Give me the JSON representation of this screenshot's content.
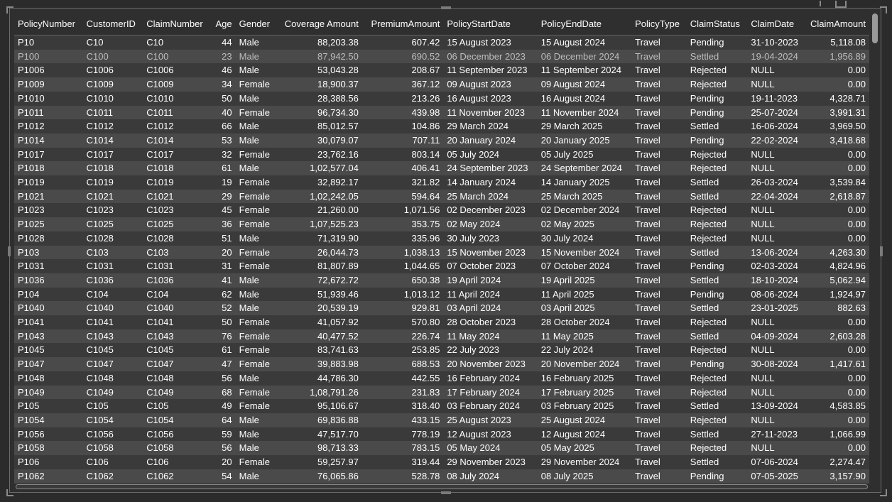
{
  "columns": [
    {
      "key": "PolicyNumber",
      "label": "PolicyNumber",
      "align": "left",
      "width": 97
    },
    {
      "key": "CustomerID",
      "label": "CustomerID",
      "align": "left",
      "width": 85
    },
    {
      "key": "ClaimNumber",
      "label": "ClaimNumber",
      "align": "left",
      "width": 95
    },
    {
      "key": "Age",
      "label": "Age",
      "align": "right",
      "width": 36
    },
    {
      "key": "Gender",
      "label": "Gender",
      "align": "left",
      "width": 57
    },
    {
      "key": "CoverageAmount",
      "label": "Coverage Amount",
      "align": "right",
      "width": 122
    },
    {
      "key": "PremiumAmount",
      "label": "PremiumAmount",
      "align": "right",
      "width": 115
    },
    {
      "key": "PolicyStartDate",
      "label": "PolicyStartDate",
      "align": "left",
      "width": 133
    },
    {
      "key": "PolicyEndDate",
      "label": "PolicyEndDate",
      "align": "left",
      "width": 133
    },
    {
      "key": "PolicyType",
      "label": "PolicyType",
      "align": "left",
      "width": 78
    },
    {
      "key": "ClaimStatus",
      "label": "ClaimStatus",
      "align": "left",
      "width": 86
    },
    {
      "key": "ClaimDate",
      "label": "ClaimDate",
      "align": "left",
      "width": 83
    },
    {
      "key": "ClaimAmount",
      "label": "ClaimAmount",
      "align": "right",
      "width": 89
    }
  ],
  "rows": [
    [
      "P10",
      "C10",
      "C10",
      "44",
      "Male",
      "88,203.38",
      "607.42",
      "15 August 2023",
      "15 August 2024",
      "Travel",
      "Pending",
      "31-10-2023",
      "5,118.08"
    ],
    [
      "P100",
      "C100",
      "C100",
      "23",
      "Male",
      "87,942.50",
      "690.52",
      "06 December 2023",
      "06 December 2024",
      "Travel",
      "Settled",
      "19-04-2024",
      "1,956.89"
    ],
    [
      "P1006",
      "C1006",
      "C1006",
      "46",
      "Male",
      "53,043.28",
      "208.67",
      "11 September 2023",
      "11 September 2024",
      "Travel",
      "Rejected",
      "NULL",
      "0.00"
    ],
    [
      "P1009",
      "C1009",
      "C1009",
      "34",
      "Female",
      "18,900.37",
      "367.12",
      "09 August 2023",
      "09 August 2024",
      "Travel",
      "Rejected",
      "NULL",
      "0.00"
    ],
    [
      "P1010",
      "C1010",
      "C1010",
      "50",
      "Male",
      "28,388.56",
      "213.26",
      "16 August 2023",
      "16 August 2024",
      "Travel",
      "Pending",
      "19-11-2023",
      "4,328.71"
    ],
    [
      "P1011",
      "C1011",
      "C1011",
      "40",
      "Female",
      "96,734.30",
      "439.98",
      "11 November 2023",
      "11 November 2024",
      "Travel",
      "Pending",
      "25-07-2024",
      "3,991.31"
    ],
    [
      "P1012",
      "C1012",
      "C1012",
      "66",
      "Male",
      "85,012.57",
      "104.86",
      "29 March 2024",
      "29 March 2025",
      "Travel",
      "Settled",
      "16-06-2024",
      "3,969.50"
    ],
    [
      "P1014",
      "C1014",
      "C1014",
      "53",
      "Male",
      "30,079.07",
      "707.11",
      "20 January 2024",
      "20 January 2025",
      "Travel",
      "Pending",
      "22-02-2024",
      "3,418.68"
    ],
    [
      "P1017",
      "C1017",
      "C1017",
      "32",
      "Female",
      "23,762.16",
      "803.14",
      "05 July 2024",
      "05 July 2025",
      "Travel",
      "Rejected",
      "NULL",
      "0.00"
    ],
    [
      "P1018",
      "C1018",
      "C1018",
      "61",
      "Male",
      "1,02,577.04",
      "406.41",
      "24 September 2023",
      "24 September 2024",
      "Travel",
      "Rejected",
      "NULL",
      "0.00"
    ],
    [
      "P1019",
      "C1019",
      "C1019",
      "19",
      "Female",
      "32,892.17",
      "321.82",
      "14 January 2024",
      "14 January 2025",
      "Travel",
      "Settled",
      "26-03-2024",
      "3,539.84"
    ],
    [
      "P1021",
      "C1021",
      "C1021",
      "29",
      "Female",
      "1,02,242.05",
      "594.64",
      "25 March 2024",
      "25 March 2025",
      "Travel",
      "Settled",
      "22-04-2024",
      "2,618.87"
    ],
    [
      "P1023",
      "C1023",
      "C1023",
      "45",
      "Female",
      "21,260.00",
      "1,071.56",
      "02 December 2023",
      "02 December 2024",
      "Travel",
      "Rejected",
      "NULL",
      "0.00"
    ],
    [
      "P1025",
      "C1025",
      "C1025",
      "36",
      "Female",
      "1,07,525.23",
      "353.75",
      "02 May 2024",
      "02 May 2025",
      "Travel",
      "Rejected",
      "NULL",
      "0.00"
    ],
    [
      "P1028",
      "C1028",
      "C1028",
      "51",
      "Male",
      "71,319.90",
      "335.96",
      "30 July 2023",
      "30 July 2024",
      "Travel",
      "Rejected",
      "NULL",
      "0.00"
    ],
    [
      "P103",
      "C103",
      "C103",
      "20",
      "Female",
      "26,044.73",
      "1,038.13",
      "15 November 2023",
      "15 November 2024",
      "Travel",
      "Settled",
      "13-06-2024",
      "4,263.30"
    ],
    [
      "P1031",
      "C1031",
      "C1031",
      "31",
      "Female",
      "81,807.89",
      "1,044.65",
      "07 October 2023",
      "07 October 2024",
      "Travel",
      "Pending",
      "02-03-2024",
      "4,824.96"
    ],
    [
      "P1036",
      "C1036",
      "C1036",
      "41",
      "Male",
      "72,672.72",
      "650.38",
      "19 April 2024",
      "19 April 2025",
      "Travel",
      "Settled",
      "18-10-2024",
      "5,062.94"
    ],
    [
      "P104",
      "C104",
      "C104",
      "62",
      "Male",
      "51,939.46",
      "1,013.12",
      "11 April 2024",
      "11 April 2025",
      "Travel",
      "Pending",
      "08-06-2024",
      "1,924.97"
    ],
    [
      "P1040",
      "C1040",
      "C1040",
      "52",
      "Male",
      "20,539.19",
      "929.81",
      "03 April 2024",
      "03 April 2025",
      "Travel",
      "Settled",
      "23-01-2025",
      "882.63"
    ],
    [
      "P1041",
      "C1041",
      "C1041",
      "50",
      "Female",
      "41,057.92",
      "570.80",
      "28 October 2023",
      "28 October 2024",
      "Travel",
      "Rejected",
      "NULL",
      "0.00"
    ],
    [
      "P1043",
      "C1043",
      "C1043",
      "76",
      "Female",
      "40,477.52",
      "226.74",
      "11 May 2024",
      "11 May 2025",
      "Travel",
      "Settled",
      "04-09-2024",
      "2,603.28"
    ],
    [
      "P1045",
      "C1045",
      "C1045",
      "61",
      "Female",
      "83,741.63",
      "253.85",
      "22 July 2023",
      "22 July 2024",
      "Travel",
      "Rejected",
      "NULL",
      "0.00"
    ],
    [
      "P1047",
      "C1047",
      "C1047",
      "47",
      "Female",
      "39,883.98",
      "688.53",
      "20 November 2023",
      "20 November 2024",
      "Travel",
      "Pending",
      "30-08-2024",
      "1,417.61"
    ],
    [
      "P1048",
      "C1048",
      "C1048",
      "56",
      "Male",
      "44,786.30",
      "442.55",
      "16 February 2024",
      "16 February 2025",
      "Travel",
      "Rejected",
      "NULL",
      "0.00"
    ],
    [
      "P1049",
      "C1049",
      "C1049",
      "68",
      "Female",
      "1,08,791.26",
      "231.83",
      "17 February 2024",
      "17 February 2025",
      "Travel",
      "Rejected",
      "NULL",
      "0.00"
    ],
    [
      "P105",
      "C105",
      "C105",
      "49",
      "Female",
      "95,106.67",
      "318.40",
      "03 February 2024",
      "03 February 2025",
      "Travel",
      "Settled",
      "13-09-2024",
      "4,583.85"
    ],
    [
      "P1054",
      "C1054",
      "C1054",
      "64",
      "Male",
      "69,836.88",
      "433.15",
      "25 August 2023",
      "25 August 2024",
      "Travel",
      "Rejected",
      "NULL",
      "0.00"
    ],
    [
      "P1056",
      "C1056",
      "C1056",
      "59",
      "Male",
      "47,517.70",
      "778.19",
      "12 August 2023",
      "12 August 2024",
      "Travel",
      "Settled",
      "27-11-2023",
      "1,066.99"
    ],
    [
      "P1058",
      "C1058",
      "C1058",
      "56",
      "Male",
      "98,713.33",
      "783.15",
      "05 May 2024",
      "05 May 2025",
      "Travel",
      "Rejected",
      "NULL",
      "0.00"
    ],
    [
      "P106",
      "C106",
      "C106",
      "20",
      "Female",
      "59,257.97",
      "319.44",
      "29 November 2023",
      "29 November 2024",
      "Travel",
      "Settled",
      "07-06-2024",
      "2,274.47"
    ],
    [
      "P1062",
      "C1062",
      "C1062",
      "54",
      "Male",
      "76,065.86",
      "528.78",
      "08 July 2024",
      "08 July 2025",
      "Travel",
      "Pending",
      "07-05-2025",
      "3,157.90"
    ]
  ],
  "colors": {
    "background": "#2b2b2b",
    "row_odd": "#3a3a3a",
    "row_even": "#4a4a4a",
    "text": "#ffffff",
    "header_rule": "#5a5f7a"
  },
  "icons": [
    "pin-icon",
    "focus-mode-icon"
  ]
}
